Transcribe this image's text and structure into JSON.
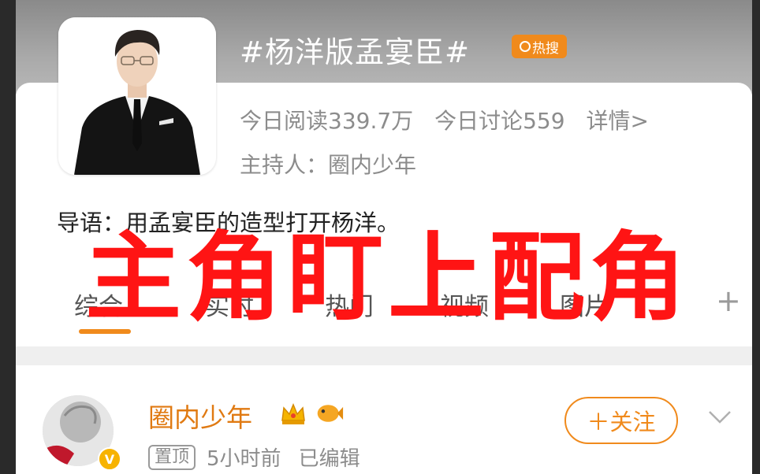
{
  "topic": {
    "title": "#杨洋版孟宴臣#",
    "hot_badge": "热搜",
    "read_today": "今日阅读339.7万",
    "discuss_today": "今日讨论559",
    "details_link": "详情>",
    "host": "主持人：圈内少年",
    "intro": "导语：用孟宴臣的造型打开杨洋。"
  },
  "tabs": {
    "items": [
      "综合",
      "实时",
      "热门",
      "视频",
      "图片"
    ],
    "add": "+"
  },
  "overlay": {
    "caption": "主角盯上配角",
    "color": "#ff1414"
  },
  "post": {
    "author": "圈内少年",
    "pinned": "置顶",
    "time": "5小时前",
    "edited": "已编辑",
    "follow": "＋关注"
  },
  "colors": {
    "accent": "#f08a1c",
    "overlay": "#ff1414"
  },
  "icons": [
    "flame-icon",
    "crown-icon",
    "fish-icon",
    "verified-icon",
    "chevron-down-icon",
    "plus-icon"
  ]
}
